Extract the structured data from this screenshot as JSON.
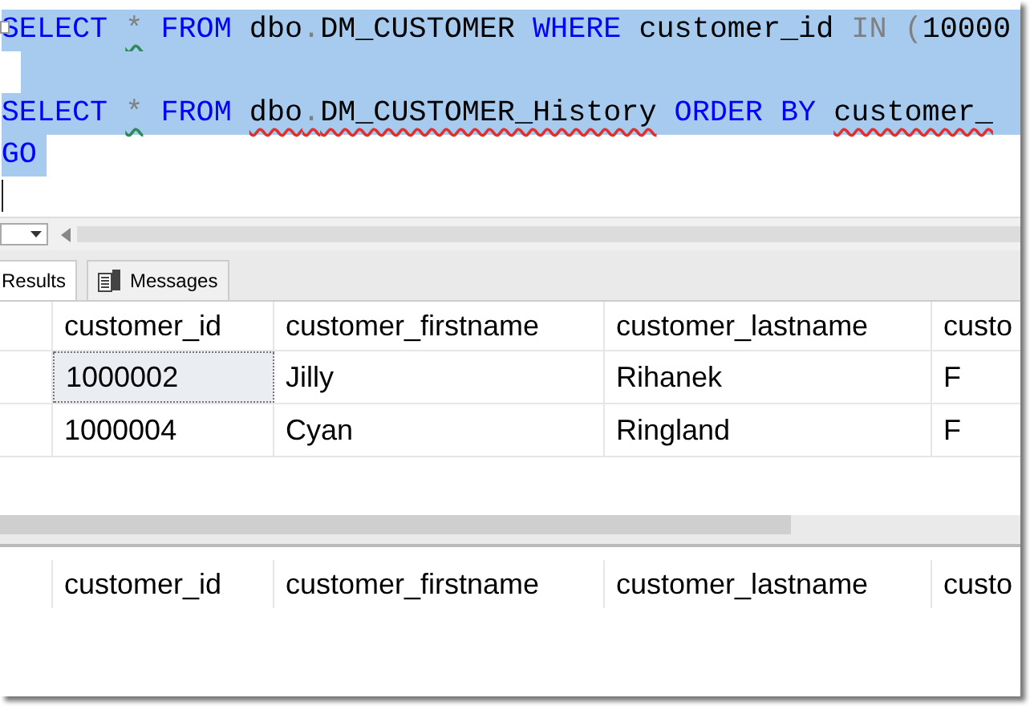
{
  "editor": {
    "lines": [
      {
        "kind": "code",
        "tokens": [
          {
            "text": "SELECT ",
            "kind": "keyword"
          },
          {
            "text": "*",
            "kind": "operator",
            "warning_squiggle": true
          },
          {
            "text": " FROM ",
            "kind": "keyword"
          },
          {
            "text": "dbo",
            "kind": "plain"
          },
          {
            "text": ".",
            "kind": "operator"
          },
          {
            "text": "DM_CUSTOMER ",
            "kind": "plain"
          },
          {
            "text": "WHERE ",
            "kind": "keyword"
          },
          {
            "text": "customer_id ",
            "kind": "plain"
          },
          {
            "text": "IN (",
            "kind": "operator"
          },
          {
            "text": "10000",
            "kind": "plain"
          }
        ]
      },
      {
        "kind": "blank"
      },
      {
        "kind": "code",
        "tokens": [
          {
            "text": "SELECT ",
            "kind": "keyword"
          },
          {
            "text": "*",
            "kind": "operator",
            "warning_squiggle": true
          },
          {
            "text": " FROM ",
            "kind": "keyword"
          },
          {
            "text": "dbo",
            "kind": "plain",
            "error_squiggle": true
          },
          {
            "text": ".",
            "kind": "operator",
            "error_squiggle": true
          },
          {
            "text": "DM_CUSTOMER_History",
            "kind": "plain",
            "error_squiggle": true
          },
          {
            "text": " ORDER BY ",
            "kind": "keyword"
          },
          {
            "text": "customer_",
            "kind": "plain",
            "error_squiggle": true
          }
        ]
      },
      {
        "kind": "code",
        "tokens": [
          {
            "text": "GO",
            "kind": "keyword"
          }
        ]
      }
    ]
  },
  "tabs": [
    {
      "label": "Results",
      "selected": true
    },
    {
      "label": "Messages",
      "selected": false
    }
  ],
  "grids": [
    {
      "columns": [
        "customer_id",
        "customer_firstname",
        "customer_lastname",
        "custo"
      ],
      "rows": [
        {
          "cells": [
            {
              "text": "1000002",
              "focused": true
            },
            {
              "text": "Jilly",
              "focused": false
            },
            {
              "text": "Rihanek",
              "focused": false
            },
            {
              "text": "F",
              "focused": false
            }
          ]
        },
        {
          "cells": [
            {
              "text": "1000004",
              "focused": false
            },
            {
              "text": "Cyan",
              "focused": false
            },
            {
              "text": "Ringland",
              "focused": false
            },
            {
              "text": "F",
              "focused": false
            }
          ]
        }
      ]
    },
    {
      "columns": [
        "customer_id",
        "customer_firstname",
        "customer_lastname",
        "custo"
      ]
    }
  ]
}
